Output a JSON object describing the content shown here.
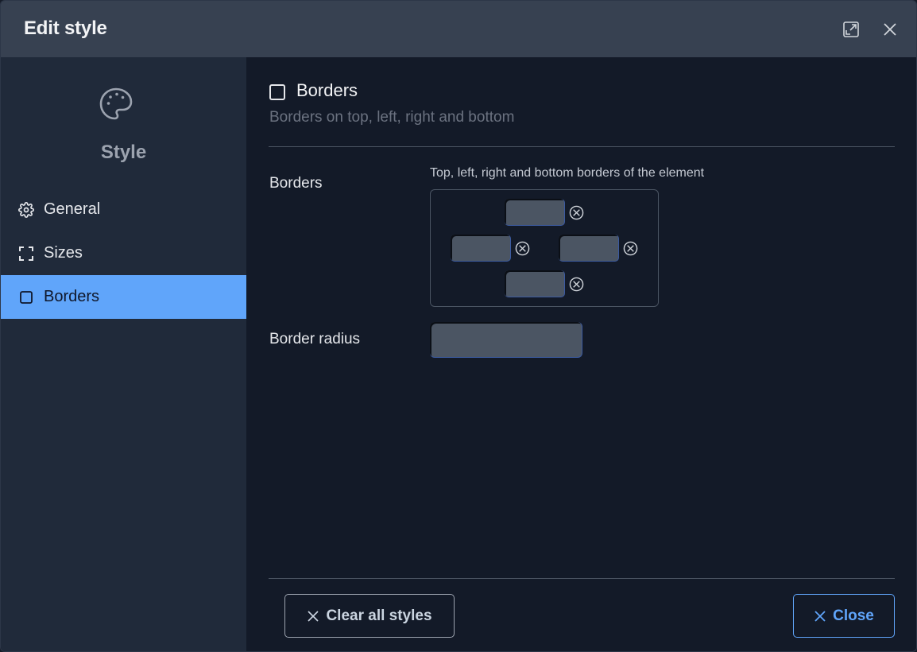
{
  "dialog": {
    "title": "Edit style"
  },
  "sidebar": {
    "title": "Style",
    "icon": "palette-icon",
    "items": [
      {
        "label": "General",
        "icon": "gear-icon"
      },
      {
        "label": "Sizes",
        "icon": "frame-corners-icon"
      },
      {
        "label": "Borders",
        "icon": "square-icon",
        "active": true
      }
    ]
  },
  "section": {
    "title": "Borders",
    "description": "Borders on top, left, right and bottom",
    "enabled": false
  },
  "fields": {
    "borders": {
      "label": "Borders",
      "hint": "Top, left, right and bottom borders of the element",
      "top": "",
      "left": "",
      "right": "",
      "bottom": ""
    },
    "border_radius": {
      "label": "Border radius",
      "value": ""
    }
  },
  "footer": {
    "clear_label": "Clear all styles",
    "close_label": "Close"
  },
  "colors": {
    "accent": "#60a5fa",
    "header_bg": "#374151",
    "sidebar_bg": "#202a3a",
    "main_bg": "#131a28"
  }
}
